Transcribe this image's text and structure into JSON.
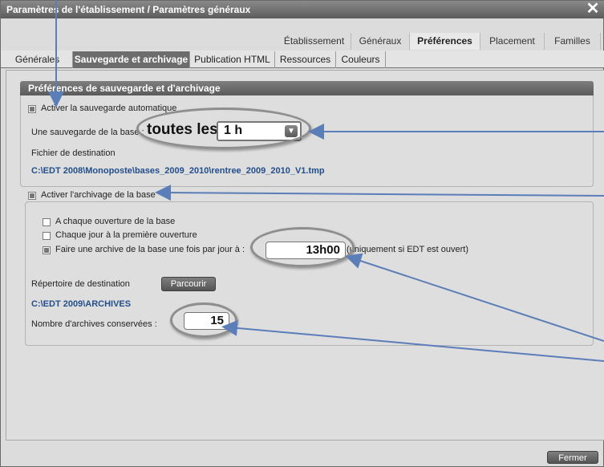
{
  "window": {
    "title": "Paramètres de l'établissement / Paramètres généraux",
    "close_glyph": "✕"
  },
  "top_tabs": [
    {
      "label": "Établissement"
    },
    {
      "label": "Généraux"
    },
    {
      "label": "Préférences"
    },
    {
      "label": "Placement"
    },
    {
      "label": "Familles"
    }
  ],
  "sub_tabs": [
    {
      "label": "Générales"
    },
    {
      "label": "Sauvegarde et archivage"
    },
    {
      "label": "Publication HTML"
    },
    {
      "label": "Ressources"
    },
    {
      "label": "Couleurs"
    }
  ],
  "section_title": "Préférences de sauvegarde et d'archivage",
  "autosave": {
    "checkbox_label": "Activer la sauvegarde automatique",
    "checked": true,
    "frequency_prefix": "Une sauvegarde de la base :",
    "frequency_zoom": "toutes les",
    "frequency_value": "1 h",
    "dest_label": "Fichier de destination",
    "dest_path": "C:\\EDT 2008\\Monoposte\\bases_2009_2010\\rentree_2009_2010_V1.tmp"
  },
  "archive": {
    "checkbox_label": "Activer l'archivage de la base",
    "checked": true,
    "options": [
      {
        "label": "A chaque ouverture de la base",
        "checked": false
      },
      {
        "label": "Chaque jour à la première ouverture",
        "checked": false
      },
      {
        "label": "Faire une archive de la base une fois par jour à :",
        "checked": true
      }
    ],
    "time_value": "13h00",
    "time_note": "(uniquement si EDT est ouvert)",
    "dir_label": "Répertoire de destination",
    "browse_label": "Parcourir",
    "dir_path": "C:\\EDT 2009\\ARCHIVES",
    "count_label": "Nombre d'archives conservées :",
    "count_value": "15"
  },
  "footer": {
    "close_label": "Fermer"
  },
  "colors": {
    "arrow": "#5b7db8",
    "link_text": "#234e8c",
    "active_tab": "#6d6d6d"
  }
}
